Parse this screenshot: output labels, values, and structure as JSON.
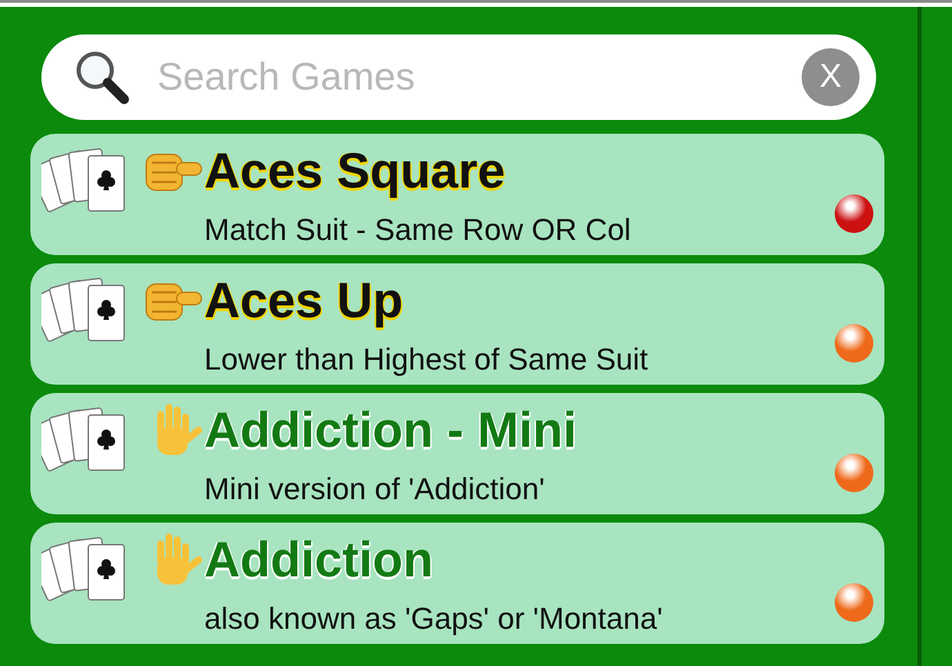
{
  "search": {
    "placeholder": "Search Games",
    "clear_label": "X"
  },
  "games": [
    {
      "title": "Aces Square",
      "description": "Match Suit - Same Row OR Col",
      "kind": "pointing",
      "color": "#cc1111"
    },
    {
      "title": "Aces Up",
      "description": "Lower than Highest of Same Suit",
      "kind": "pointing",
      "color": "#ee6a1a"
    },
    {
      "title": "Addiction - Mini",
      "description": "Mini version of 'Addiction'",
      "kind": "raised",
      "color": "#ee6a1a"
    },
    {
      "title": "Addiction",
      "description": "also known as 'Gaps' or 'Montana'",
      "kind": "raised",
      "color": "#ee6a1a"
    }
  ]
}
